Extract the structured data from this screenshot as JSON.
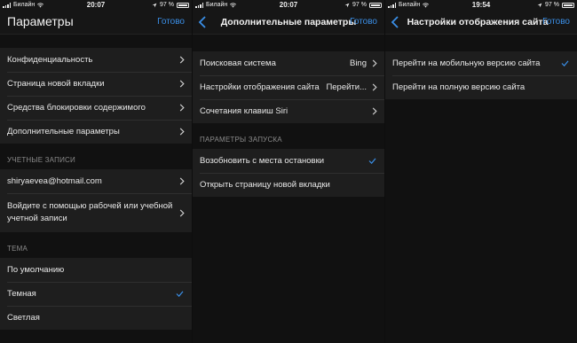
{
  "colors": {
    "accent": "#3a8ee6",
    "background": "#111111",
    "cell": "#1e1e1e",
    "section_text": "#8a8a8a"
  },
  "panels": [
    {
      "status": {
        "carrier": "Билайн",
        "time": "20:07",
        "battery": "97 %"
      },
      "nav": {
        "title": "Параметры",
        "done": "Готово"
      },
      "groups": [
        {
          "rows": [
            {
              "label": "Конфиденциальность"
            },
            {
              "label": "Страница новой вкладки"
            },
            {
              "label": "Средства блокировки содержимого"
            },
            {
              "label": "Дополнительные параметры"
            }
          ]
        },
        {
          "header": "УЧЕТНЫЕ ЗАПИСИ",
          "rows": [
            {
              "label": "shiryaevea@hotmail.com"
            },
            {
              "label": "Войдите с помощью рабочей или учебной учетной записи"
            }
          ]
        },
        {
          "header": "ТЕМА",
          "rows": [
            {
              "label": "По умолчанию"
            },
            {
              "label": "Темная"
            },
            {
              "label": "Светлая"
            }
          ]
        }
      ]
    },
    {
      "status": {
        "carrier": "Билайн",
        "time": "20:07",
        "battery": "97 %"
      },
      "nav": {
        "title": "Дополнительные параметры",
        "done": "Готово"
      },
      "groups": [
        {
          "rows": [
            {
              "label": "Поисковая система",
              "value": "Bing"
            },
            {
              "label": "Настройки отображения сайта",
              "value": "Перейти..."
            },
            {
              "label": "Сочетания клавиш Siri"
            }
          ]
        },
        {
          "header": "ПАРАМЕТРЫ ЗАПУСКА",
          "rows": [
            {
              "label": "Возобновить с места остановки"
            },
            {
              "label": "Открыть страницу новой вкладки"
            }
          ]
        }
      ]
    },
    {
      "status": {
        "carrier": "Билайн",
        "time": "19:54",
        "battery": "97 %"
      },
      "nav": {
        "title": "Настройки отображения сайта",
        "done": "Готово"
      },
      "groups": [
        {
          "rows": [
            {
              "label": "Перейти на мобильную версию сайта"
            },
            {
              "label": "Перейти на полную версию сайта"
            }
          ]
        }
      ]
    }
  ]
}
